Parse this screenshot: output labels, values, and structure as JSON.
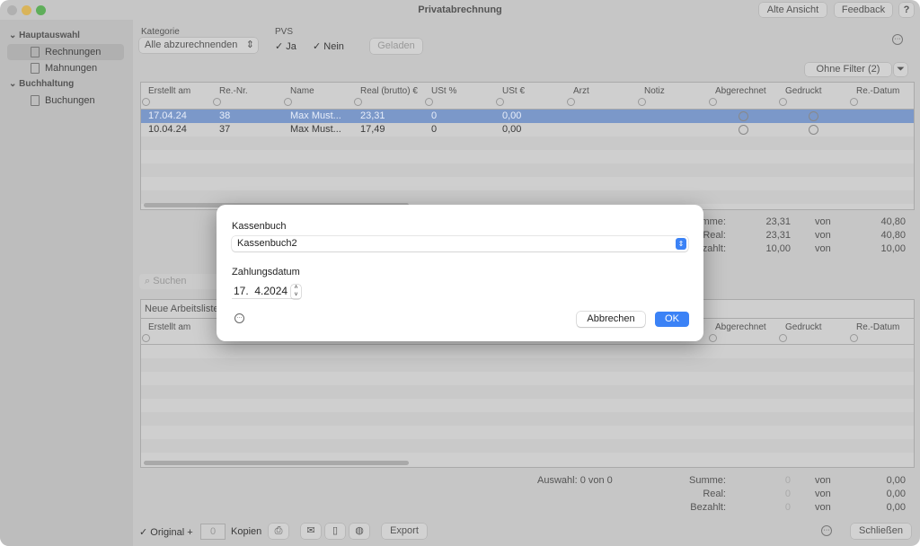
{
  "window": {
    "title": "Privatabrechnung",
    "buttons": [
      "Alte Ansicht",
      "Feedback",
      "?"
    ]
  },
  "sidebar": {
    "sections": [
      {
        "label": "Hauptauswahl",
        "items": [
          "Rechnungen",
          "Mahnungen"
        ]
      },
      {
        "label": "Buchhaltung",
        "items": [
          "Buchungen"
        ]
      }
    ]
  },
  "filters": {
    "kategorie_label": "Kategorie",
    "kategorie_value": "Alle abzurechnenden",
    "pvs_label": "PVS",
    "ja": "Ja",
    "nein": "Nein",
    "geladen": "Geladen",
    "ohne_filter": "Ohne Filter (2)"
  },
  "table": {
    "columns": [
      "Erstellt am",
      "Re.-Nr.",
      "Name",
      "Real (brutto) €",
      "USt %",
      "USt €",
      "Arzt",
      "Notiz",
      "Abgerechnet",
      "Gedruckt",
      "Re.-Datum"
    ],
    "rows": [
      {
        "erstellt": "17.04.24",
        "nr": "38",
        "name": "Max Must...",
        "real": "23,31",
        "ust_pct": "0",
        "ust_eur": "0,00",
        "selected": true
      },
      {
        "erstellt": "10.04.24",
        "nr": "37",
        "name": "Max Must...",
        "real": "17,49",
        "ust_pct": "0",
        "ust_eur": "0,00",
        "selected": false
      }
    ]
  },
  "summary_top": {
    "rows": [
      {
        "label": "Summe:",
        "value": "23,31",
        "von": "von",
        "total": "40,80"
      },
      {
        "label": "Real:",
        "value": "23,31",
        "von": "von",
        "total": "40,80"
      },
      {
        "label": "Bezahlt:",
        "value": "10,00",
        "von": "von",
        "total": "10,00"
      }
    ]
  },
  "search_placeholder": "Suchen",
  "worklist": {
    "title": "Neue Arbeitsliste",
    "columns": [
      "Erstellt am",
      "Abgerechnet",
      "Gedruckt",
      "Re.-Datum"
    ]
  },
  "summary_bottom": {
    "auswahl": "Auswahl:  0 von 0",
    "rows": [
      {
        "label": "Summe:",
        "value": "0",
        "von": "von",
        "total": "0,00"
      },
      {
        "label": "Real:",
        "value": "0",
        "von": "von",
        "total": "0,00"
      },
      {
        "label": "Bezahlt:",
        "value": "0",
        "von": "von",
        "total": "0,00"
      }
    ]
  },
  "footer": {
    "original": "Original",
    "plus": "+",
    "kopien_value": "0",
    "kopien": "Kopien",
    "export": "Export",
    "schliessen": "Schließen"
  },
  "dialog": {
    "kassenbuch_label": "Kassenbuch",
    "kassenbuch_value": "Kassenbuch2",
    "datum_label": "Zahlungsdatum",
    "datum_value": "17.  4.2024",
    "cancel": "Abbrechen",
    "ok": "OK",
    "accent": "#3b82f6"
  }
}
